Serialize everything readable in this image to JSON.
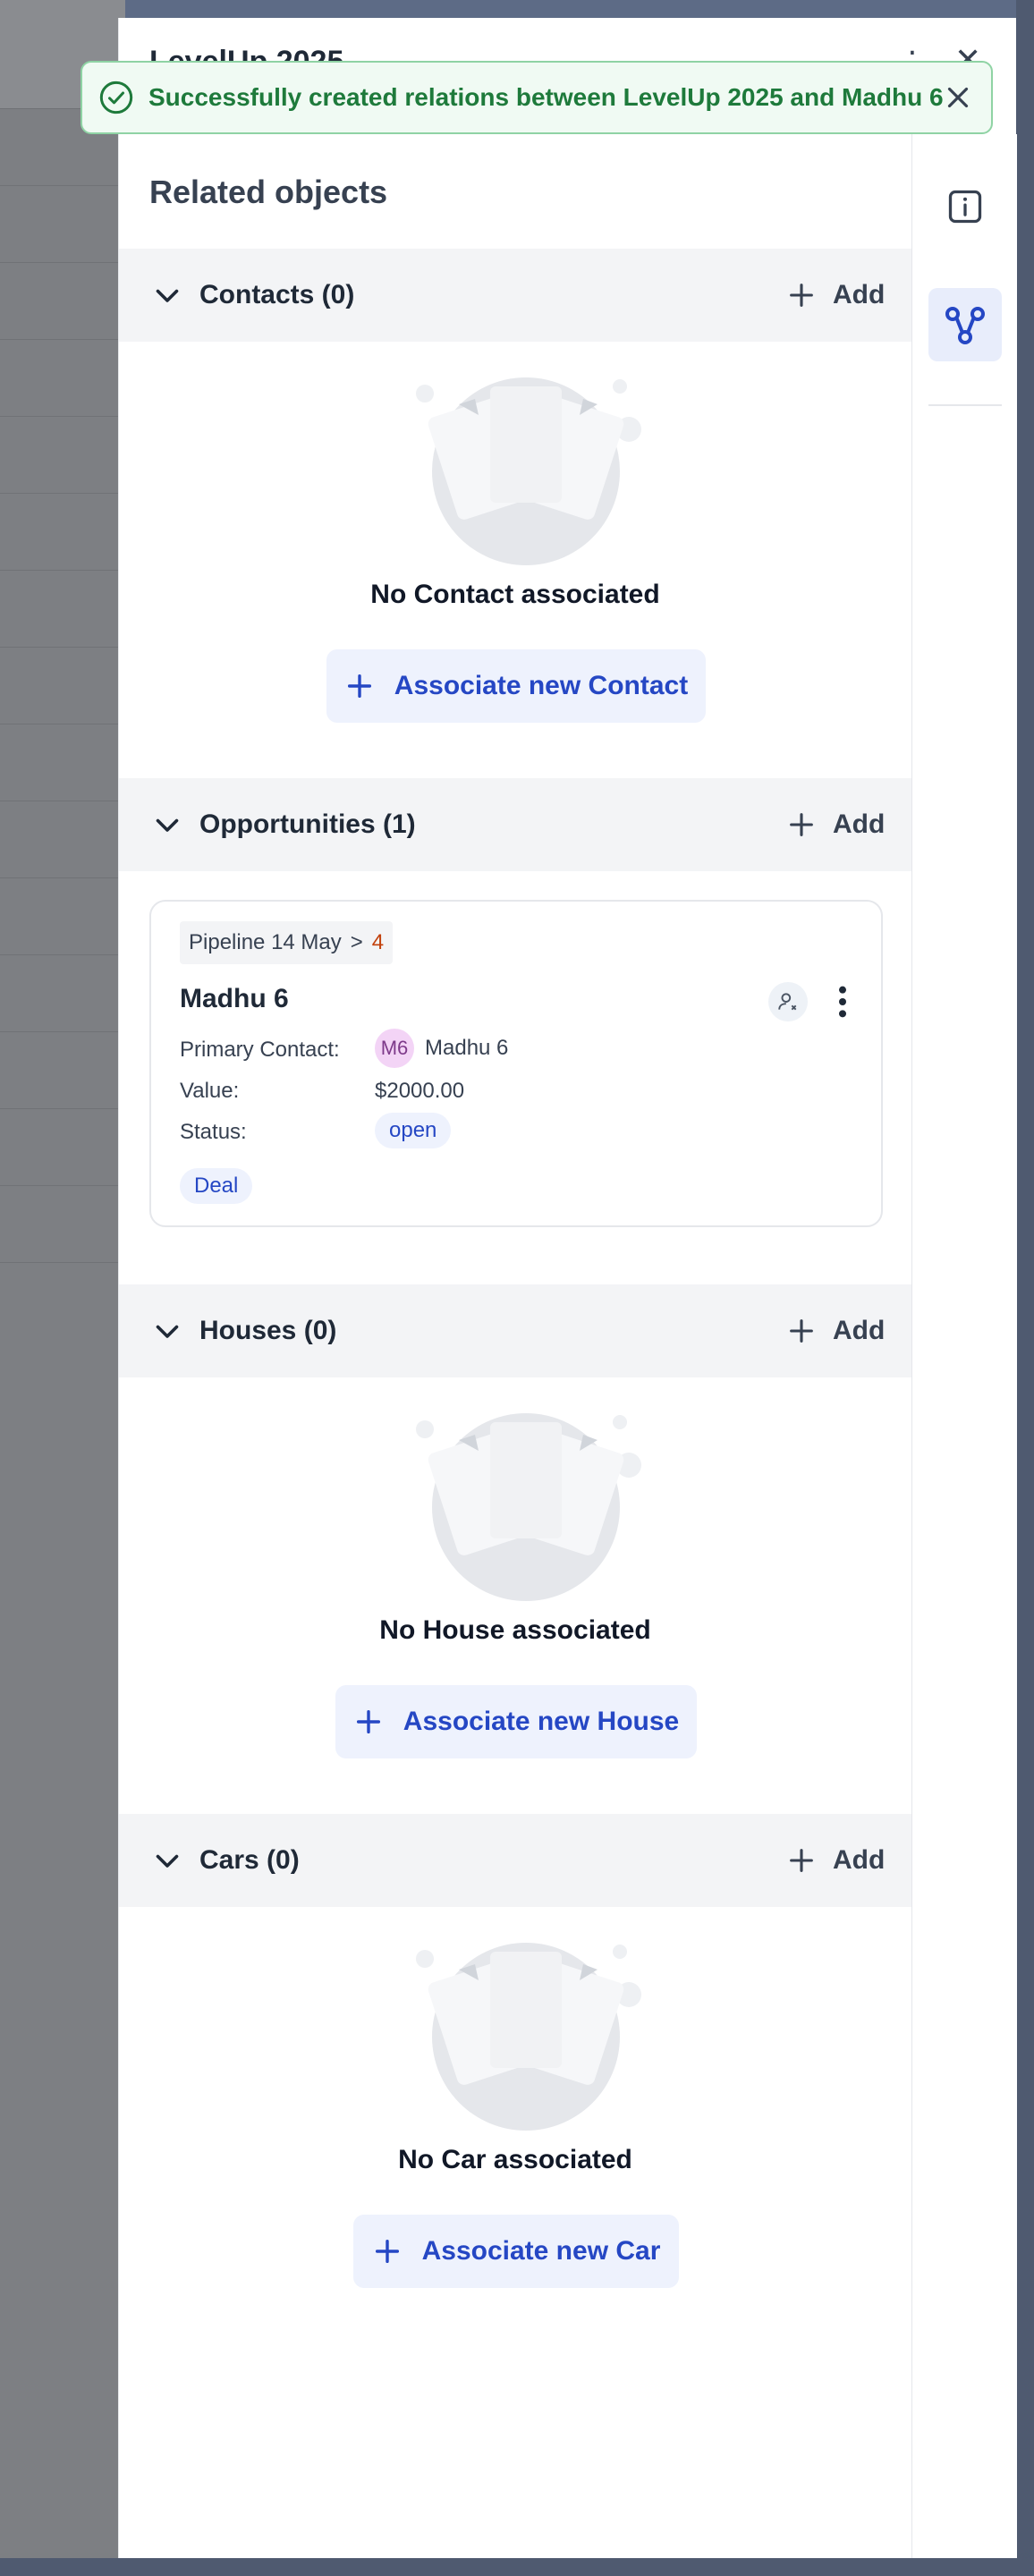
{
  "panel": {
    "title": "LevelUp 2025"
  },
  "toast": {
    "message": "Successfully created relations between LevelUp 2025 and Madhu 6"
  },
  "related": {
    "title": "Related objects"
  },
  "sections": {
    "contacts": {
      "label": "Contacts (0)",
      "add_label": "Add",
      "empty_text": "No Contact associated",
      "assoc_label": "Associate new Contact"
    },
    "opportunities": {
      "label": "Opportunities (1)",
      "add_label": "Add"
    },
    "houses": {
      "label": "Houses (0)",
      "add_label": "Add",
      "empty_text": "No House associated",
      "assoc_label": "Associate new House"
    },
    "cars": {
      "label": "Cars (0)",
      "add_label": "Add",
      "empty_text": "No Car associated",
      "assoc_label": "Associate new Car"
    }
  },
  "opportunity": {
    "pipeline": "Pipeline 14 May",
    "crumb_separator": ">",
    "stage": "4",
    "name": "Madhu 6",
    "primary_contact_label": "Primary Contact:",
    "contact_initials": "M6",
    "contact_name": "Madhu 6",
    "value_label": "Value:",
    "value": "$2000.00",
    "status_label": "Status:",
    "status": "open",
    "tag": "Deal"
  },
  "icons": {
    "toast": "check-circle-icon",
    "close": "close-icon",
    "chevron": "chevron-down-icon",
    "plus": "plus-icon",
    "info": "info-icon",
    "relations": "relations-icon",
    "more": "more-vertical-icon",
    "owner": "user-remove-icon"
  },
  "colors": {
    "accent": "#2547c4",
    "success": "#1e7a3b",
    "stage": "#c2410c"
  }
}
